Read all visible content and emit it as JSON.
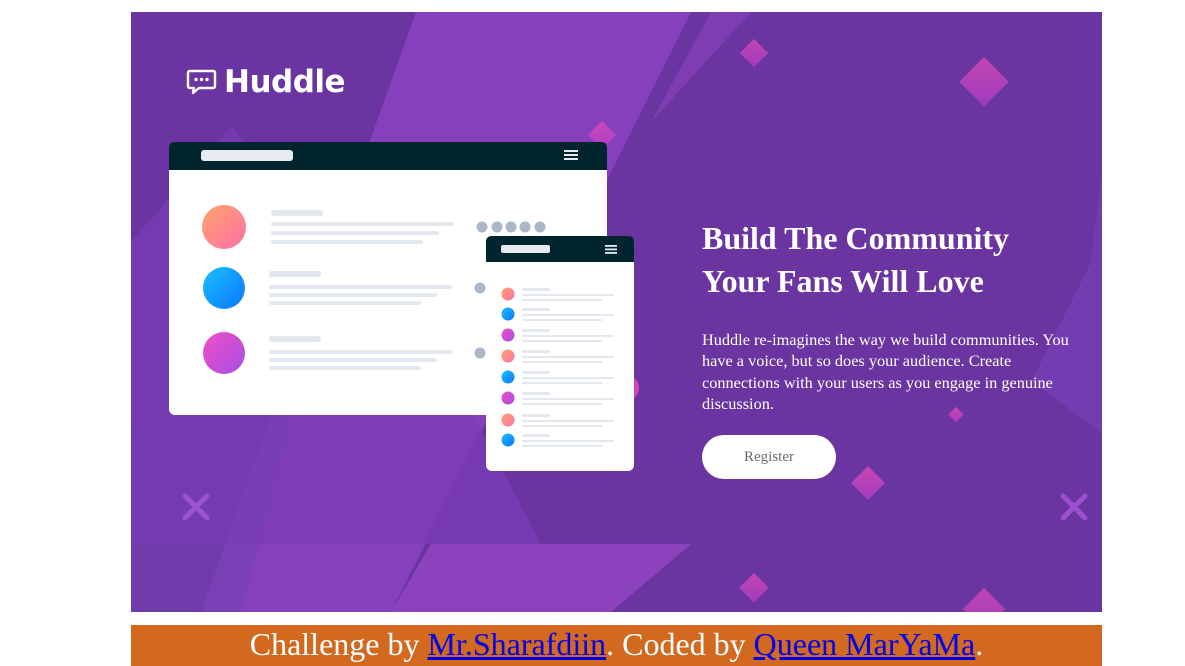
{
  "brand": {
    "name": "Huddle",
    "logo_icon": "chat-bubble-icon"
  },
  "hero": {
    "headline": "Build The Community Your Fans Will Love",
    "description": "Huddle re-imagines the way we build communities. You have a voice, but so does your audience. Create connections with your users as you engage in genuine discussion.",
    "cta_label": "Register"
  },
  "footer": {
    "prefix": "Challenge by ",
    "challenge_author": "Mr.Sharafdiin",
    "middle": ". Coded by ",
    "coder": "Queen MarYaMa",
    "suffix": "."
  },
  "colors": {
    "hero_background": "#6a35a0",
    "accent_pink": "#e04ab5",
    "footer_background": "#d2691e",
    "link": "#0000ee",
    "mockup_header": "#00252e"
  }
}
